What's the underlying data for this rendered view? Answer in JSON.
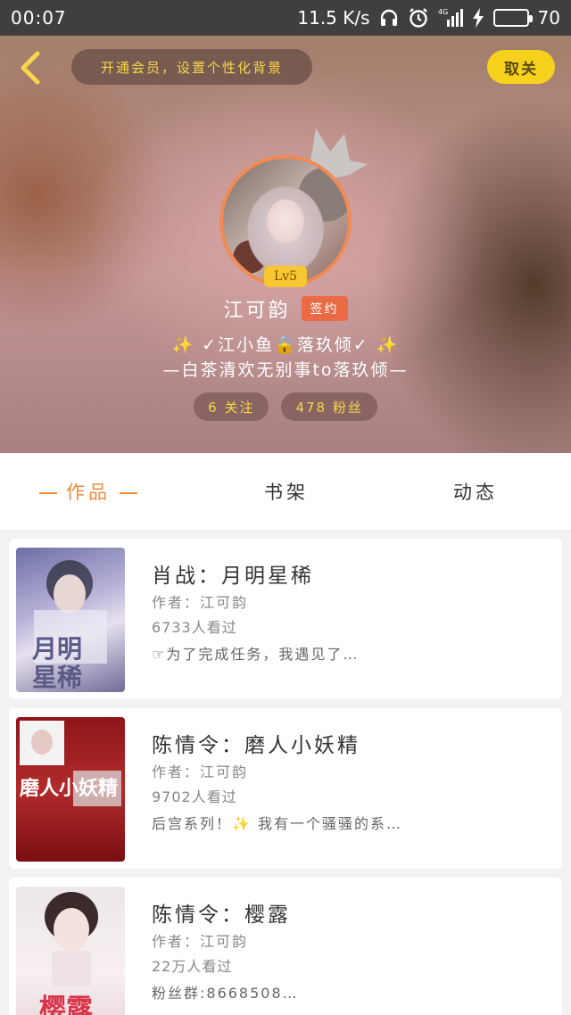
{
  "status_bar": {
    "time": "00:07",
    "net_speed": "11.5 K/s",
    "battery": "70",
    "signal": "4G"
  },
  "header": {
    "vip_text": "开通会员，设置个性化背景",
    "unfollow_label": "取关"
  },
  "profile": {
    "level": "Lv5",
    "username": "江可韵",
    "signed_badge": "签约",
    "bio_line1": "✨ ✓江小鱼🔒落玖倾✓ ✨",
    "bio_line2": "—白茶清欢无别事tо落玖倾—",
    "following": "6 关注",
    "fans": "478 粉丝"
  },
  "tabs": [
    {
      "label": "作品",
      "active": true
    },
    {
      "label": "书架",
      "active": false
    },
    {
      "label": "动态",
      "active": false
    }
  ],
  "works": [
    {
      "title": "肖战：月明星稀",
      "author": "作者：江可韵",
      "views": "6733人看过",
      "desc": "☞为了完成任务，我遇见了…",
      "cover_text": "月明星稀"
    },
    {
      "title": "陈情令：磨人小妖精",
      "author": "作者：江可韵",
      "views": "9702人看过",
      "desc": "后宫系列！✨ 我有一个骚骚的系…",
      "cover_text": "磨人小妖精"
    },
    {
      "title": "陈情令：樱露",
      "author": "作者：江可韵",
      "views": "22万人看过",
      "desc": "粉丝群:8668508…",
      "cover_text": "樱露"
    }
  ],
  "colors": {
    "accent": "#f08a3e",
    "vip_gold": "#f6d64a",
    "unfollow_bg": "#f7d21c",
    "signed_bg": "#ea6a43",
    "battery_green": "#3ed65a"
  }
}
